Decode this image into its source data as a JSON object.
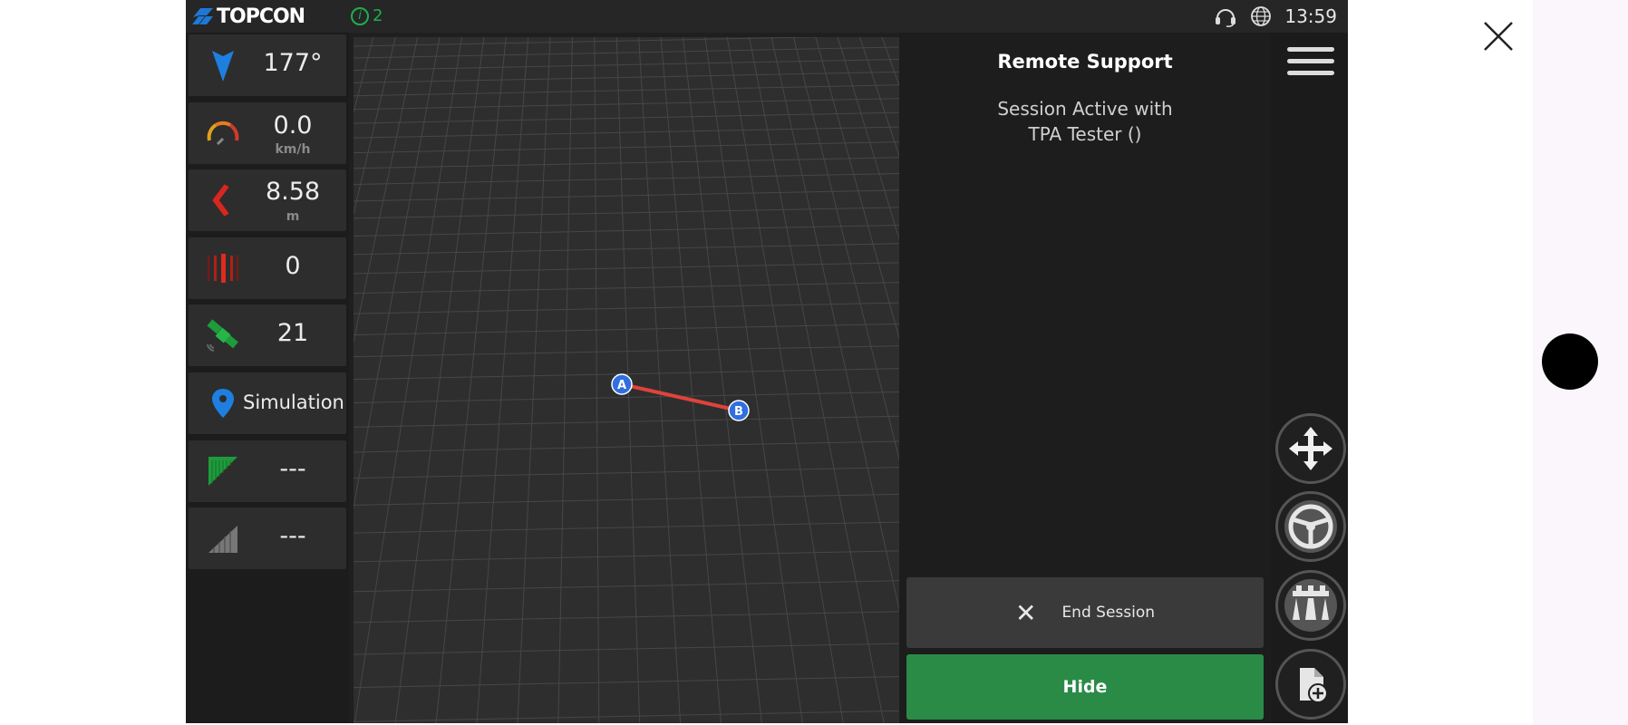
{
  "brand": {
    "logo_text": "TOPCON"
  },
  "statusbar": {
    "info_count": "2",
    "clock": "13:59",
    "icons": [
      "headset-icon",
      "globe-icon"
    ]
  },
  "tiles": [
    {
      "icon": "heading-arrow-icon",
      "value": "177°",
      "unit": ""
    },
    {
      "icon": "speedometer-icon",
      "value": "0.0",
      "unit": "km/h"
    },
    {
      "icon": "offline-distance-icon",
      "value": "8.58",
      "unit": "m"
    },
    {
      "icon": "guidance-lines-icon",
      "value": "0",
      "unit": ""
    },
    {
      "icon": "satellite-icon",
      "value": "21",
      "unit": ""
    },
    {
      "icon": "location-pin-icon",
      "value": "Simulation",
      "unit": ""
    },
    {
      "icon": "coverage-flag-icon",
      "value": "---",
      "unit": ""
    },
    {
      "icon": "signal-icon",
      "value": "---",
      "unit": ""
    }
  ],
  "map": {
    "point_a": "A",
    "point_b": "B",
    "line_color": "#e0433b",
    "point_color": "#2f6fe0"
  },
  "remote_support": {
    "title": "Remote Support",
    "line1": "Session Active with",
    "line2": "TPA Tester ()",
    "end_session_label": "End Session",
    "hide_label": "Hide"
  },
  "colors": {
    "accent_green": "#2a8b47",
    "info_green": "#1fae4a"
  }
}
